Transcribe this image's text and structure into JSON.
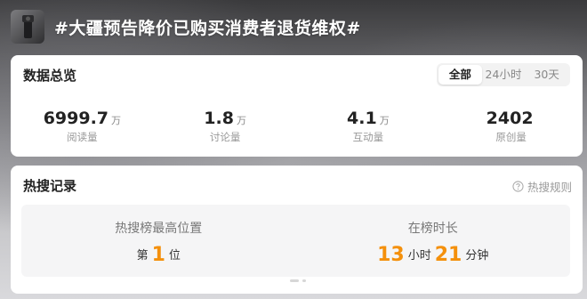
{
  "topic": {
    "title": "#大疆预告降价已购买消费者退货维权#"
  },
  "overview": {
    "title": "数据总览",
    "tabs": [
      {
        "label": "全部",
        "active": true
      },
      {
        "label": "24小时",
        "active": false
      },
      {
        "label": "30天",
        "active": false
      }
    ],
    "stats": [
      {
        "value": "6999.7",
        "unit": "万",
        "label": "阅读量"
      },
      {
        "value": "1.8",
        "unit": "万",
        "label": "讨论量"
      },
      {
        "value": "4.1",
        "unit": "万",
        "label": "互动量"
      },
      {
        "value": "2402",
        "unit": "",
        "label": "原创量"
      }
    ]
  },
  "hot": {
    "title": "热搜记录",
    "rules_label": "热搜规则",
    "highest": {
      "label": "热搜榜最高位置",
      "prefix": "第",
      "number": "1",
      "suffix": "位"
    },
    "duration": {
      "label": "在榜时长",
      "hours": "13",
      "hours_unit": "小时",
      "minutes": "21",
      "minutes_unit": "分钟"
    }
  },
  "colors": {
    "accent": "#f4900c",
    "text_main": "#222222",
    "text_muted": "#999999"
  }
}
